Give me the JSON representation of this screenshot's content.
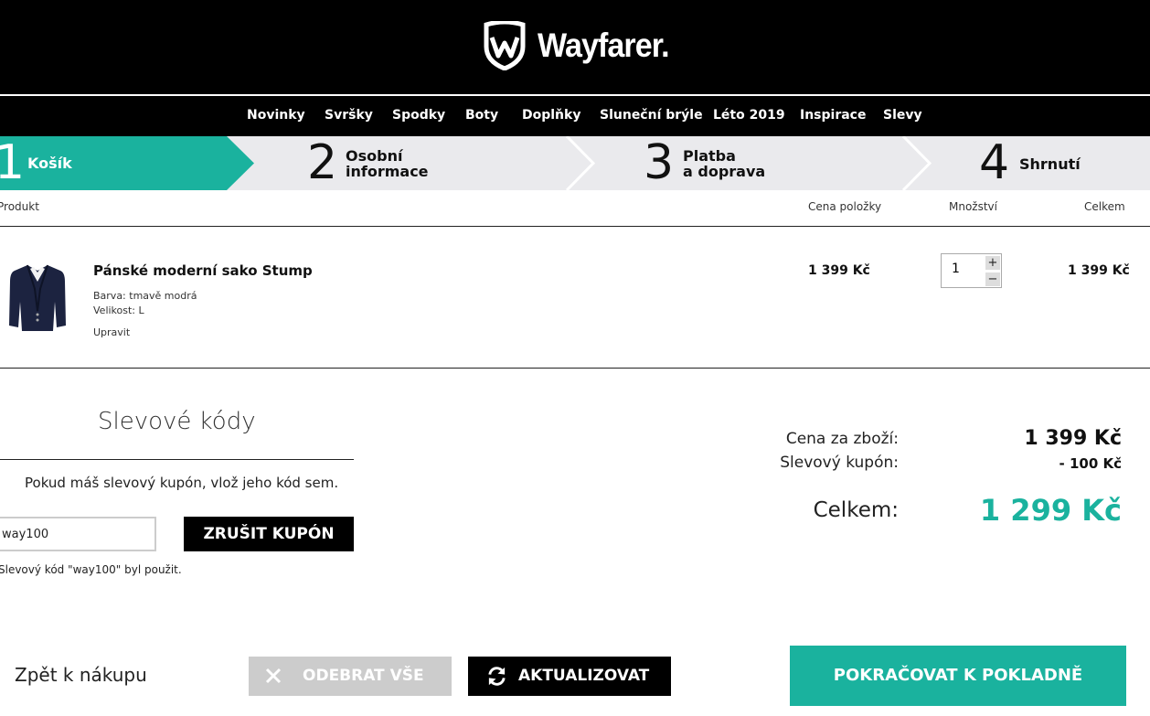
{
  "header": {
    "logo_text": "Wayfarer."
  },
  "nav": [
    "Novinky",
    "Svršky",
    "Spodky",
    "Boty",
    "Doplňky",
    "Sluneční brýle",
    "Léto 2019",
    "Inspirace",
    "Slevy"
  ],
  "steps": [
    {
      "num": "1",
      "label": "Košík"
    },
    {
      "num": "2",
      "label_l1": "Osobní",
      "label_l2": "informace"
    },
    {
      "num": "3",
      "label_l1": "Platba",
      "label_l2": "a doprava"
    },
    {
      "num": "4",
      "label": "Shrnutí"
    }
  ],
  "cart_columns": {
    "product": "Produkt",
    "unit_price": "Cena položky",
    "quantity": "Množství",
    "total": "Celkem"
  },
  "item": {
    "name": "Pánské moderní sako Stump",
    "color": "Barva:  tmavě modrá",
    "size": "Velikost:  L",
    "edit": "Upravit",
    "unit_price": "1 399 Kč",
    "quantity": "1",
    "plus": "+",
    "minus": "−",
    "total": "1 399 Kč"
  },
  "coupon": {
    "title": "Slevové kódy",
    "info": "Pokud máš slevový kupón, vlož jeho kód sem.",
    "code": "way100",
    "cancel_button": "ZRUŠIT KUPÓN",
    "note": "Slevový kód \"way100\" byl použit."
  },
  "summary": {
    "goods_label": "Cena za zboží:",
    "goods_value": "1 399 Kč",
    "discount_label": "Slevový kupón:",
    "discount_value": "- 100 Kč",
    "total_label": "Celkem:",
    "total_value": "1 299 Kč"
  },
  "actions": {
    "back": "Zpět k nákupu",
    "remove_all": "ODEBRAT VŠE",
    "update": "AKTUALIZOVAT",
    "checkout": "POKRAČOVAT K POKLADNĚ"
  },
  "colors": {
    "accent": "#1ab29e",
    "header_bg": "#000000",
    "steps_bg": "#eaeaed"
  }
}
